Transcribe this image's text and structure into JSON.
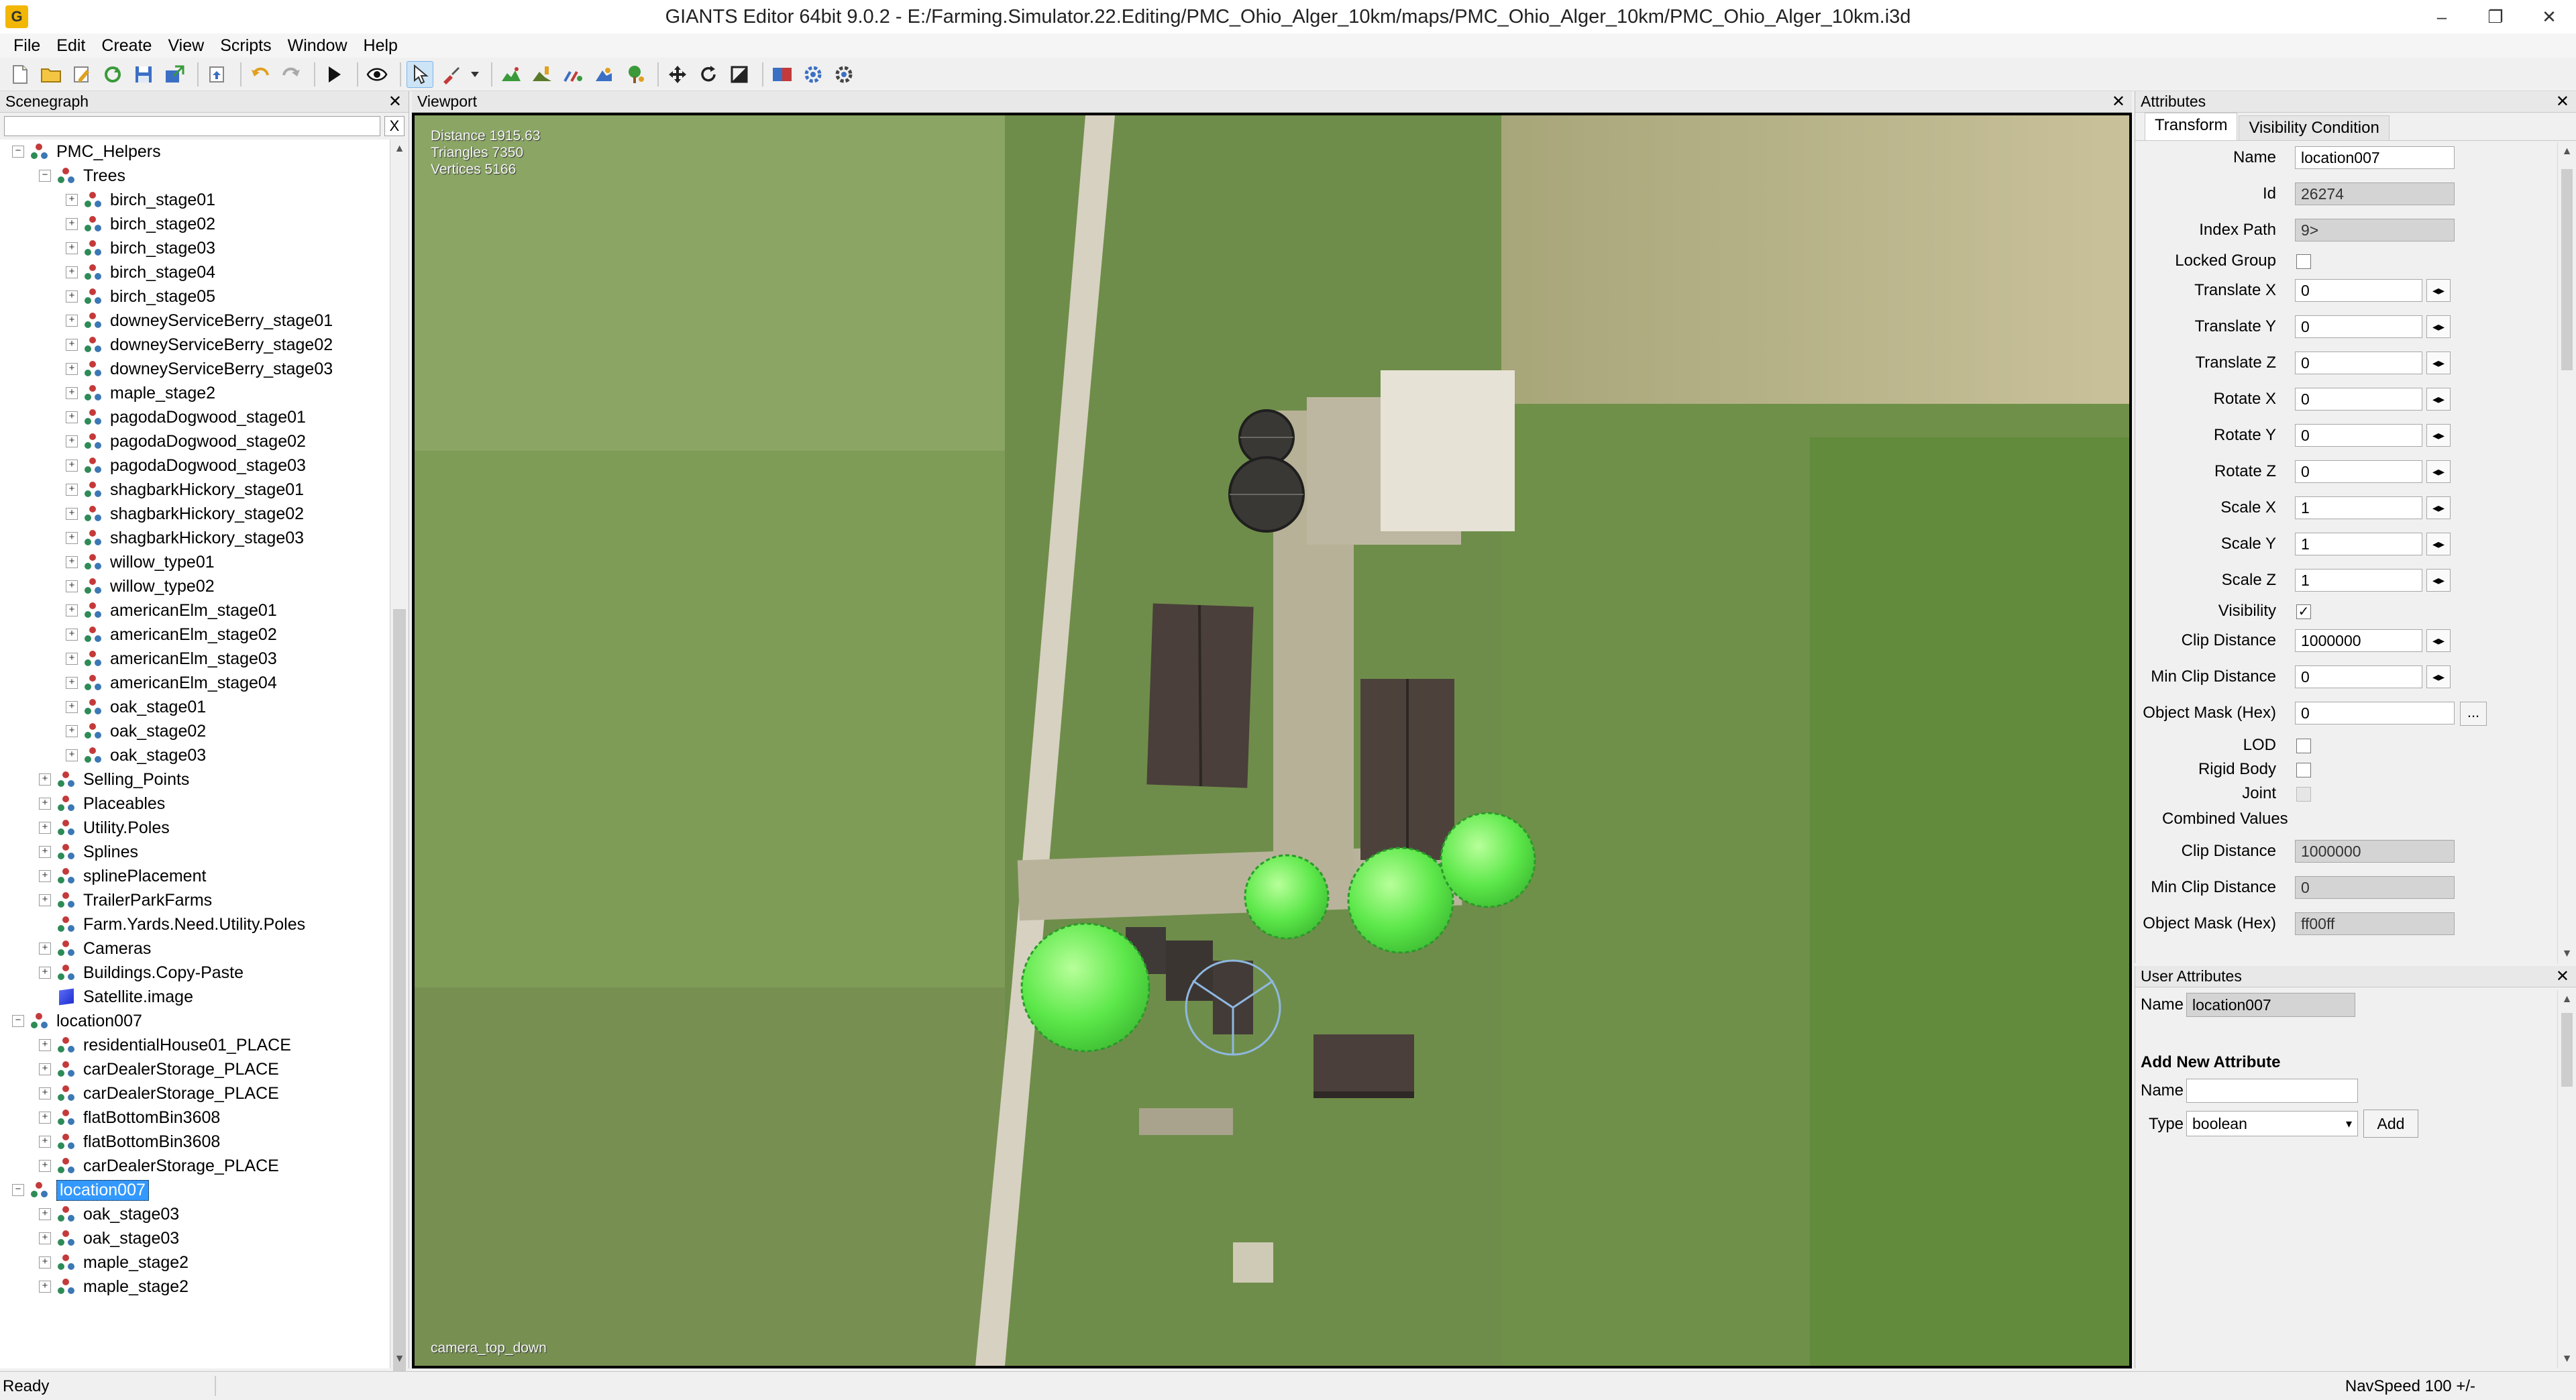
{
  "titlebar": {
    "title": "GIANTS Editor 64bit 9.0.2 - E:/Farming.Simulator.22.Editing/PMC_Ohio_Alger_10km/maps/PMC_Ohio_Alger_10km/PMC_Ohio_Alger_10km.i3d",
    "minimize": "–",
    "maximize": "❐",
    "close": "✕"
  },
  "menu": [
    "File",
    "Edit",
    "Create",
    "View",
    "Scripts",
    "Window",
    "Help"
  ],
  "scenegraph": {
    "title": "Scenegraph",
    "close": "✕",
    "filter_value": "",
    "clear_label": "X",
    "rows": [
      {
        "label": "PMC_Helpers",
        "indent": 0,
        "toggle": "−",
        "icon": "transform"
      },
      {
        "label": "Trees",
        "indent": 1,
        "toggle": "−",
        "icon": "transform"
      },
      {
        "label": "birch_stage01",
        "indent": 2,
        "toggle": "+",
        "icon": "transform"
      },
      {
        "label": "birch_stage02",
        "indent": 2,
        "toggle": "+",
        "icon": "transform"
      },
      {
        "label": "birch_stage03",
        "indent": 2,
        "toggle": "+",
        "icon": "transform"
      },
      {
        "label": "birch_stage04",
        "indent": 2,
        "toggle": "+",
        "icon": "transform"
      },
      {
        "label": "birch_stage05",
        "indent": 2,
        "toggle": "+",
        "icon": "transform"
      },
      {
        "label": "downeyServiceBerry_stage01",
        "indent": 2,
        "toggle": "+",
        "icon": "transform"
      },
      {
        "label": "downeyServiceBerry_stage02",
        "indent": 2,
        "toggle": "+",
        "icon": "transform"
      },
      {
        "label": "downeyServiceBerry_stage03",
        "indent": 2,
        "toggle": "+",
        "icon": "transform"
      },
      {
        "label": "maple_stage2",
        "indent": 2,
        "toggle": "+",
        "icon": "transform"
      },
      {
        "label": "pagodaDogwood_stage01",
        "indent": 2,
        "toggle": "+",
        "icon": "transform"
      },
      {
        "label": "pagodaDogwood_stage02",
        "indent": 2,
        "toggle": "+",
        "icon": "transform"
      },
      {
        "label": "pagodaDogwood_stage03",
        "indent": 2,
        "toggle": "+",
        "icon": "transform"
      },
      {
        "label": "shagbarkHickory_stage01",
        "indent": 2,
        "toggle": "+",
        "icon": "transform"
      },
      {
        "label": "shagbarkHickory_stage02",
        "indent": 2,
        "toggle": "+",
        "icon": "transform"
      },
      {
        "label": "shagbarkHickory_stage03",
        "indent": 2,
        "toggle": "+",
        "icon": "transform"
      },
      {
        "label": "willow_type01",
        "indent": 2,
        "toggle": "+",
        "icon": "transform"
      },
      {
        "label": "willow_type02",
        "indent": 2,
        "toggle": "+",
        "icon": "transform"
      },
      {
        "label": "americanElm_stage01",
        "indent": 2,
        "toggle": "+",
        "icon": "transform"
      },
      {
        "label": "americanElm_stage02",
        "indent": 2,
        "toggle": "+",
        "icon": "transform"
      },
      {
        "label": "americanElm_stage03",
        "indent": 2,
        "toggle": "+",
        "icon": "transform"
      },
      {
        "label": "americanElm_stage04",
        "indent": 2,
        "toggle": "+",
        "icon": "transform"
      },
      {
        "label": "oak_stage01",
        "indent": 2,
        "toggle": "+",
        "icon": "transform"
      },
      {
        "label": "oak_stage02",
        "indent": 2,
        "toggle": "+",
        "icon": "transform"
      },
      {
        "label": "oak_stage03",
        "indent": 2,
        "toggle": "+",
        "icon": "transform"
      },
      {
        "label": "Selling_Points",
        "indent": 1,
        "toggle": "+",
        "icon": "transform"
      },
      {
        "label": "Placeables",
        "indent": 1,
        "toggle": "+",
        "icon": "transform"
      },
      {
        "label": "Utility.Poles",
        "indent": 1,
        "toggle": "+",
        "icon": "transform"
      },
      {
        "label": "Splines",
        "indent": 1,
        "toggle": "+",
        "icon": "transform"
      },
      {
        "label": "splinePlacement",
        "indent": 1,
        "toggle": "+",
        "icon": "transform"
      },
      {
        "label": "TrailerParkFarms",
        "indent": 1,
        "toggle": "+",
        "icon": "transform"
      },
      {
        "label": "Farm.Yards.Need.Utility.Poles",
        "indent": 1,
        "toggle": "",
        "icon": "transform"
      },
      {
        "label": "Cameras",
        "indent": 1,
        "toggle": "+",
        "icon": "transform"
      },
      {
        "label": "Buildings.Copy-Paste",
        "indent": 1,
        "toggle": "+",
        "icon": "transform"
      },
      {
        "label": "Satellite.image",
        "indent": 1,
        "toggle": "",
        "icon": "shape"
      },
      {
        "label": "location007",
        "indent": 0,
        "toggle": "−",
        "icon": "transform"
      },
      {
        "label": "residentialHouse01_PLACE",
        "indent": 1,
        "toggle": "+",
        "icon": "transform"
      },
      {
        "label": "carDealerStorage_PLACE",
        "indent": 1,
        "toggle": "+",
        "icon": "transform"
      },
      {
        "label": "carDealerStorage_PLACE",
        "indent": 1,
        "toggle": "+",
        "icon": "transform"
      },
      {
        "label": "flatBottomBin3608",
        "indent": 1,
        "toggle": "+",
        "icon": "transform"
      },
      {
        "label": "flatBottomBin3608",
        "indent": 1,
        "toggle": "+",
        "icon": "transform"
      },
      {
        "label": "carDealerStorage_PLACE",
        "indent": 1,
        "toggle": "+",
        "icon": "transform"
      },
      {
        "label": "location007",
        "indent": 0,
        "toggle": "−",
        "icon": "transform",
        "selected": true
      },
      {
        "label": "oak_stage03",
        "indent": 1,
        "toggle": "+",
        "icon": "transform"
      },
      {
        "label": "oak_stage03",
        "indent": 1,
        "toggle": "+",
        "icon": "transform"
      },
      {
        "label": "maple_stage2",
        "indent": 1,
        "toggle": "+",
        "icon": "transform"
      },
      {
        "label": "maple_stage2",
        "indent": 1,
        "toggle": "+",
        "icon": "transform"
      }
    ]
  },
  "viewport": {
    "title": "Viewport",
    "close": "✕",
    "stats": {
      "distance": "Distance 1915.63",
      "triangles": "Triangles 7350",
      "vertices": "Vertices 5166"
    },
    "camera": "camera_top_down",
    "colors": {
      "field": "#7e9a55",
      "road": "#cfc8b8",
      "roof": "#4a3f3a",
      "tree": "#6ef05a"
    }
  },
  "attributes": {
    "title": "Attributes",
    "close": "✕",
    "tabs": [
      "Transform",
      "Visibility Condition"
    ],
    "name_label": "Name",
    "name_value": "location007",
    "id_label": "Id",
    "id_value": "26274",
    "index_path_label": "Index Path",
    "index_path_value": "9>",
    "locked_group_label": "Locked Group",
    "translate_x_label": "Translate X",
    "translate_x_value": "0",
    "translate_y_label": "Translate Y",
    "translate_y_value": "0",
    "translate_z_label": "Translate Z",
    "translate_z_value": "0",
    "rotate_x_label": "Rotate X",
    "rotate_x_value": "0",
    "rotate_y_label": "Rotate Y",
    "rotate_y_value": "0",
    "rotate_z_label": "Rotate Z",
    "rotate_z_value": "0",
    "scale_x_label": "Scale X",
    "scale_x_value": "1",
    "scale_y_label": "Scale Y",
    "scale_y_value": "1",
    "scale_z_label": "Scale Z",
    "scale_z_value": "1",
    "visibility_label": "Visibility",
    "visibility_check": "✓",
    "clip_distance_label": "Clip Distance",
    "clip_distance_value": "1000000",
    "min_clip_distance_label": "Min Clip Distance",
    "min_clip_distance_value": "0",
    "object_mask_label": "Object Mask (Hex)",
    "object_mask_value": "0",
    "dots": "...",
    "lod_label": "LOD",
    "rigid_body_label": "Rigid Body",
    "joint_label": "Joint",
    "combined_values_label": "Combined Values",
    "combined_clip_distance_value": "1000000",
    "combined_min_clip_distance_value": "0",
    "combined_object_mask_value": "ff00ff",
    "spin": "◂▸"
  },
  "user_attributes": {
    "title": "User Attributes",
    "close": "✕",
    "name_label": "Name",
    "name_value": "location007",
    "add_new_label": "Add New Attribute",
    "new_name_label": "Name",
    "new_name_value": "",
    "type_label": "Type",
    "type_value": "boolean",
    "add_button": "Add"
  },
  "statusbar": {
    "status": "Ready",
    "navspeed": "NavSpeed 100 +/-"
  }
}
